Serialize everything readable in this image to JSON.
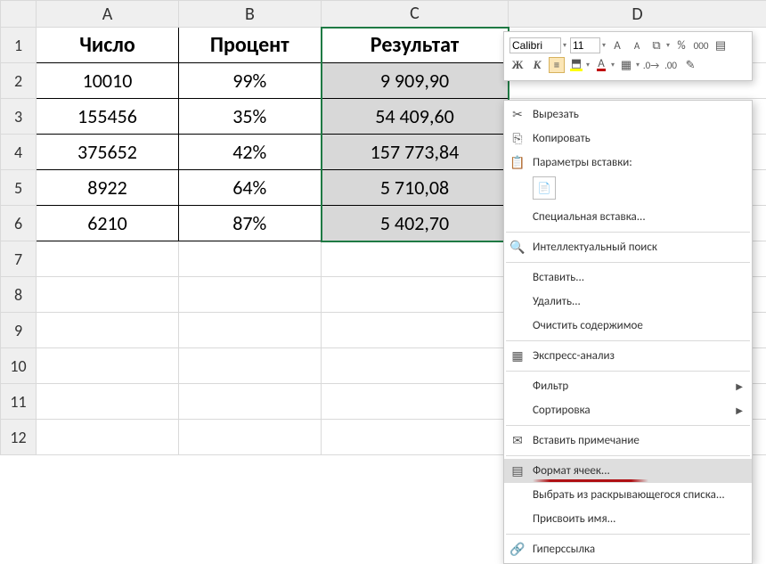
{
  "columns": [
    "A",
    "B",
    "C",
    "D"
  ],
  "rows": [
    "1",
    "2",
    "3",
    "4",
    "5",
    "6",
    "7",
    "8",
    "9",
    "10",
    "11",
    "12"
  ],
  "headers": {
    "A": "Число",
    "B": "Процент",
    "C": "Результат"
  },
  "data": [
    {
      "a": "10010",
      "b": "99%",
      "c": "9 909,90"
    },
    {
      "a": "155456",
      "b": "35%",
      "c": "54 409,60"
    },
    {
      "a": "375652",
      "b": "42%",
      "c": "157 773,84"
    },
    {
      "a": "8922",
      "b": "64%",
      "c": "5 710,08"
    },
    {
      "a": "6210",
      "b": "87%",
      "c": "5 402,70"
    }
  ],
  "mini_toolbar": {
    "font_name": "Calibri",
    "font_size": "11",
    "increase_font": "A",
    "decrease_font": "A",
    "percent": "%",
    "thousands": "000",
    "bold": "Ж",
    "italic": "К",
    "font_color_letter": "A",
    "format_painter": "✎"
  },
  "context_menu": {
    "cut": "Вырезать",
    "copy": "Копировать",
    "paste_options": "Параметры вставки:",
    "paste_special": "Специальная вставка...",
    "smart_lookup": "Интеллектуальный поиск",
    "insert": "Вставить...",
    "delete": "Удалить...",
    "clear_contents": "Очистить содержимое",
    "quick_analysis": "Экспресс-анализ",
    "filter": "Фильтр",
    "sort": "Сортировка",
    "insert_comment": "Вставить примечание",
    "format_cells": "Формат ячеек...",
    "pick_from_list": "Выбрать из раскрывающегося списка...",
    "define_name": "Присвоить имя...",
    "hyperlink": "Гиперссылка"
  }
}
